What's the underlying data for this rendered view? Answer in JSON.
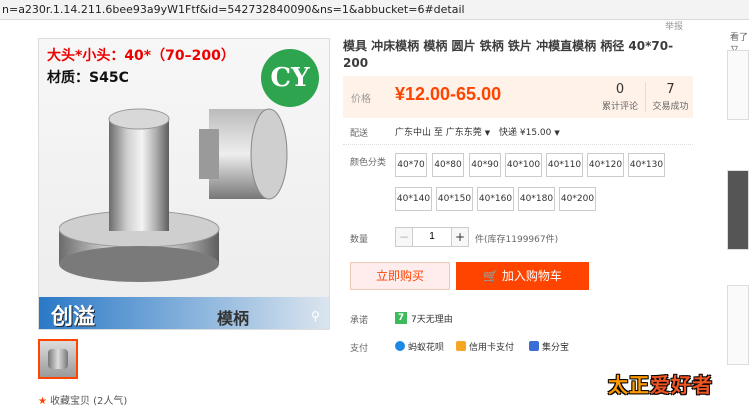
{
  "browser": {
    "url": "n=a230r.1.14.211.6bee93a9yW1Ftf&id=542732840090&ns=1&abbucket=6#detail"
  },
  "report_label": "举报",
  "gallery": {
    "promo_line1": "大头*小头：40*（70–200）",
    "promo_line2": "材质：S45C",
    "logo_text": "CY",
    "band_brand": "创溢",
    "band_label": "模柄"
  },
  "product": {
    "title": "模具 冲床模柄 模柄 圆片 铁柄 铁片 冲模直模柄 柄径 40*70-200",
    "price_label": "价格",
    "price": "¥12.00-65.00",
    "review_count": "0",
    "review_label": "累计评论",
    "sales_count": "7",
    "sales_label": "交易成功",
    "shipping_label": "配送",
    "ship_from": "广东中山 至",
    "ship_to": "广东东莞",
    "ship_method": "快递 ¥15.00",
    "color_label": "颜色分类",
    "sku_options": [
      "40*70",
      "40*80",
      "40*90",
      "40*100",
      "40*110",
      "40*120",
      "40*130",
      "40*140",
      "40*150",
      "40*160",
      "40*180",
      "40*200"
    ],
    "qty_label": "数量",
    "qty_minus": "−",
    "qty_plus": "+",
    "qty_value": "1",
    "stock_text": "件(库存1199967件)",
    "buy_now_label": "立即购买",
    "add_cart_label": "加入购物车",
    "cart_icon": "🛒",
    "promise_label": "承诺",
    "promise_icon": "7",
    "promise_text": "7天无理由",
    "pay_label": "支付",
    "pay_methods": [
      "蚂蚁花呗",
      "信用卡支付",
      "集分宝"
    ],
    "favorite_text": "收藏宝贝 (2人气)",
    "star_icon": "★"
  },
  "sidebar": {
    "label": "看了又"
  },
  "watermark": {
    "part1": "太正",
    "part2": "爱好者"
  }
}
